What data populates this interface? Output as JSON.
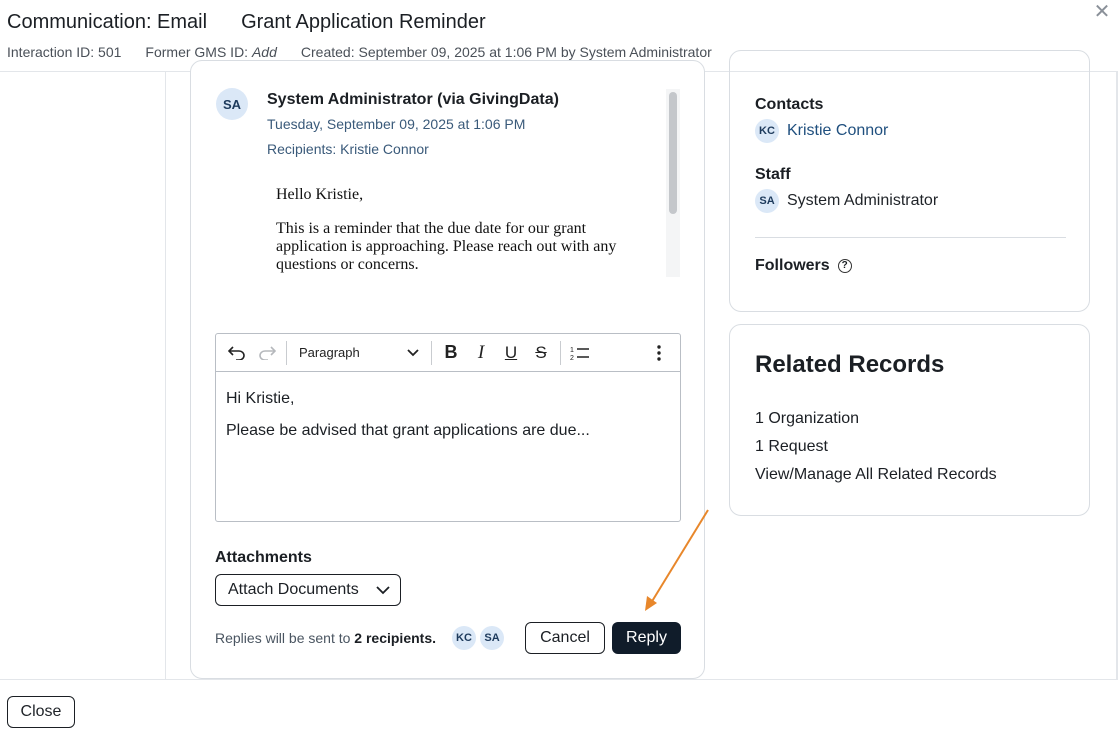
{
  "header": {
    "type_title": "Communication: Email",
    "subject_title": "Grant Application Reminder",
    "interaction_id": "Interaction ID: 501",
    "former_gms_label": "Former GMS ID:",
    "former_gms_value": "Add",
    "created": "Created: September 09, 2025 at 1:06 PM by System Administrator",
    "close_icon": "close-icon"
  },
  "message": {
    "avatar_initials": "SA",
    "from": "System Administrator (via GivingData)",
    "date": "Tuesday, September 09, 2025 at 1:06 PM",
    "recipients": "Recipients: Kristie Connor",
    "body_greeting": "Hello Kristie,",
    "body_text": "This is a reminder that the due date for our grant application is approaching. Please reach out with any questions or concerns."
  },
  "editor": {
    "block_format": "Paragraph",
    "content_line1": "Hi Kristie,",
    "content_line2": "Please be advised that grant applications are due..."
  },
  "attachments": {
    "label": "Attachments",
    "button_label": "Attach Documents"
  },
  "reply_footer": {
    "note_prefix": "Replies will be sent to ",
    "note_count": "2 recipients.",
    "recipient_avatars": [
      "KC",
      "SA"
    ],
    "cancel_label": "Cancel",
    "reply_label": "Reply"
  },
  "people": {
    "contacts_label": "Contacts",
    "contact": {
      "initials": "KC",
      "name": "Kristie Connor"
    },
    "staff_label": "Staff",
    "staff": {
      "initials": "SA",
      "name": "System Administrator"
    },
    "followers_label": "Followers"
  },
  "related": {
    "title": "Related Records",
    "organizations": "1 Organization",
    "requests": "1 Request",
    "manage_link": "View/Manage All Related Records"
  },
  "footer": {
    "close_label": "Close"
  },
  "colors": {
    "accent_link": "#1f4f7e",
    "primary_button": "#101c2a",
    "avatar_bg": "#dbe8f7",
    "annotation_arrow": "#e8872b"
  }
}
